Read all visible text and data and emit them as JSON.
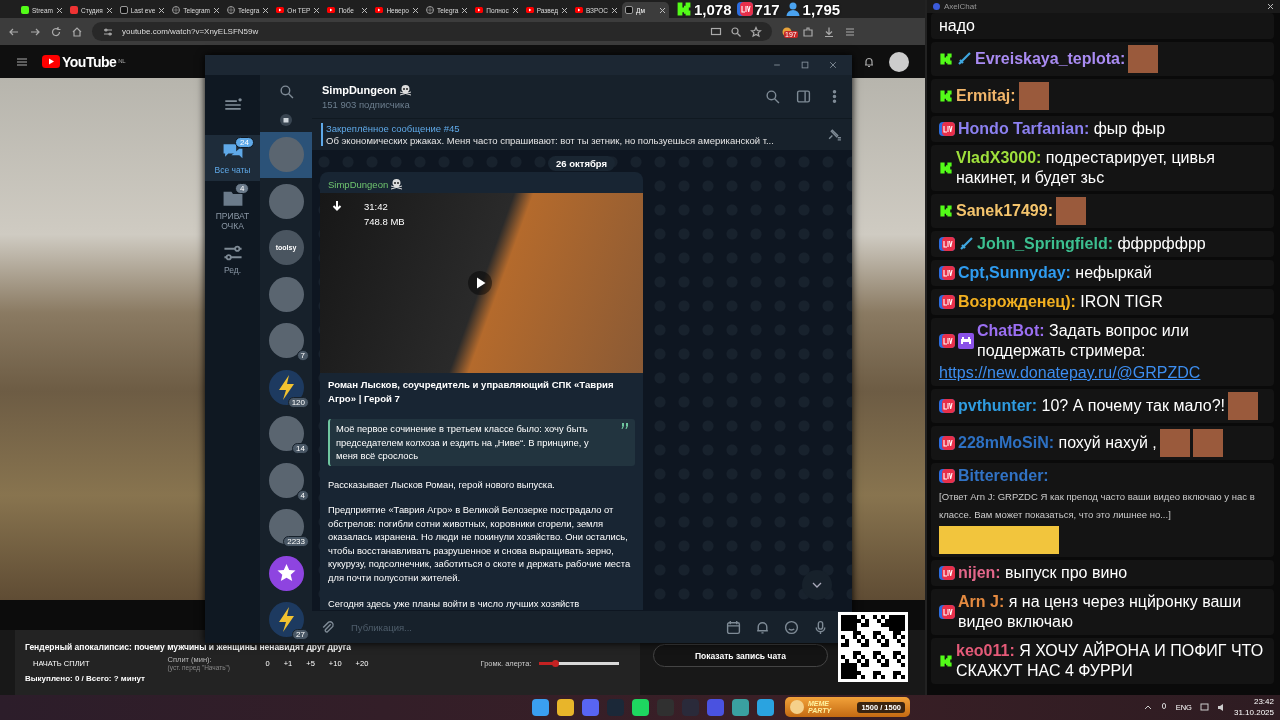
{
  "browser": {
    "tabs": [
      {
        "label": "Stream",
        "kind": "kick",
        "selected": false
      },
      {
        "label": "Студия",
        "kind": "studio",
        "selected": false
      },
      {
        "label": "Last eve",
        "kind": "dark",
        "selected": false
      },
      {
        "label": "Telegram",
        "kind": "globe",
        "selected": false
      },
      {
        "label": "Telegra",
        "kind": "globe",
        "selected": false
      },
      {
        "label": "Он ТЕР",
        "kind": "youtube",
        "selected": false
      },
      {
        "label": "Побе",
        "kind": "youtube",
        "selected": false
      },
      {
        "label": "Неверо",
        "kind": "youtube",
        "selected": false
      },
      {
        "label": "Telegra",
        "kind": "globe",
        "selected": false
      },
      {
        "label": "Полнос",
        "kind": "youtube",
        "selected": false
      },
      {
        "label": "Развед",
        "kind": "youtube",
        "selected": false
      },
      {
        "label": "ВЗРОС",
        "kind": "youtube",
        "selected": false
      },
      {
        "label": "Дм",
        "kind": "dark",
        "selected": true
      }
    ],
    "address": "youtube.com/watch?v=XnyELSFN59w",
    "extension_badge": "197"
  },
  "stream_overlay": {
    "kick_viewers": "1,078",
    "live_viewers": "717",
    "total_viewers": "1,795"
  },
  "youtube": {
    "logo": "YouTube",
    "region": "NL"
  },
  "telegram": {
    "folders": [
      {
        "label": "Все чаты",
        "kind": "chats",
        "badge": "24",
        "selected": true
      },
      {
        "label": "ПРИВАТ ОЧКА",
        "kind": "folder",
        "badge": "4",
        "selected": false
      },
      {
        "label": "Ред.",
        "kind": "edit",
        "selected": false
      }
    ],
    "chats": [
      {
        "kind": "photo",
        "selected": true
      },
      {
        "kind": "photo",
        "selected": false
      },
      {
        "kind": "logo",
        "avatar_text": "toolsy",
        "selected": false
      },
      {
        "kind": "photo",
        "selected": false
      },
      {
        "kind": "photo",
        "badge": "7",
        "selected": false
      },
      {
        "kind": "bolt",
        "badge": "120",
        "selected": false
      },
      {
        "kind": "photo",
        "badge": "14",
        "selected": false
      },
      {
        "kind": "photo",
        "badge": "4",
        "selected": false
      },
      {
        "kind": "photo",
        "badge": "2233",
        "selected": false
      },
      {
        "kind": "star",
        "selected": false
      },
      {
        "kind": "bolt",
        "badge": "27",
        "selected": false
      }
    ],
    "channel": {
      "name": "SimpDungeon",
      "subscribers": "151 903 подписчика"
    },
    "pinned": {
      "title": "Закреплённое сообщение #45",
      "text": "Об экономических ржаках.  Меня часто спрашивают: вот ты зетник, но пользуешься американской т..."
    },
    "date": "26 октября",
    "message": {
      "sender": "SimpDungeon",
      "video": {
        "duration": "31:42",
        "size": "748.8 MB"
      },
      "caption": "Роман Лысков, соучредитель и управляющий СПК «Таврия Агро» | Герой 7",
      "quote": "Моё первое сочинение в третьем классе было: хочу быть председателем колхоза и ездить на „Ниве“. В принципе, у меня всё срослось",
      "paragraphs": [
        "Рассказывает Лысков Роман, герой нового выпуска.",
        "Предприятие «Таврия Агро» в Великой Белозерке пострадало от обстрелов: погибли сотни животных, коровники сгорели, земля оказалась изранена. Но люди не покинули хозяйство. Они остались, чтобы восстанавливать разрушенное и снова выращивать зерно, кукурузу, подсолнечник, заботиться о скоте и держать рабочие места для почти полусотни жителей.",
        "Сегодня здесь уже планы войти в число лучших хозяйств"
      ]
    },
    "composer": {
      "placeholder": "Публикация..."
    }
  },
  "split_widget": {
    "title": "Гендерный апокалипсис: почему мужчины и женщины ненавидят друг друга",
    "start_button": "НАЧАТЬ СПЛИТ",
    "split_label": "Сплит (мин):",
    "split_hint": "(уст. перед \"Начать\")",
    "values": [
      "0",
      "+1",
      "+5",
      "+10",
      "+20"
    ],
    "volume_label": "Громк. алерта:",
    "volume": {
      "level": 0.2
    },
    "bought": "Выкуплено: 0 / Всего: ? минут"
  },
  "chat_record_button": "Показать запись чата",
  "meme_party": {
    "title": "MEME PARTY",
    "count": "1500 / 1500"
  },
  "chat": {
    "title": "AxelChat",
    "messages": [
      {
        "text": "надо"
      },
      {
        "icons": [
          {
            "kind": "kick"
          },
          {
            "kind": "sword"
          }
        ],
        "name": "Evreiskaya_teplota:",
        "color": "#a98bf2",
        "emotes": [
          {
            "kind": "square"
          }
        ]
      },
      {
        "icons": [
          {
            "kind": "kick"
          }
        ],
        "name": "Ermitaj:",
        "color": "#f2b66a",
        "emotes": [
          {
            "kind": "square"
          }
        ]
      },
      {
        "icons": [
          {
            "kind": "live"
          }
        ],
        "name": "Hondo Tarfanian:",
        "color": "#8c80f0",
        "text": "фыр фыр"
      },
      {
        "icons": [
          {
            "kind": "kick"
          }
        ],
        "name": "VladX3000:",
        "color": "#9fe03c",
        "text": "подрестарирует, цивья накинет, и будет зьс"
      },
      {
        "icons": [
          {
            "kind": "kick"
          }
        ],
        "name": "Sanek17499:",
        "color": "#f4c46c",
        "emotes": [
          {
            "kind": "square"
          }
        ]
      },
      {
        "icons": [
          {
            "kind": "live"
          },
          {
            "kind": "sword"
          }
        ],
        "name": "John_Springfield:",
        "color": "#3cbf90",
        "text": "ффррффрр"
      },
      {
        "icons": [
          {
            "kind": "live"
          }
        ],
        "name": "Cpt,Sunnyday:",
        "color": "#2f9cf0",
        "text": "нефыркай"
      },
      {
        "icons": [
          {
            "kind": "live"
          }
        ],
        "name": "Возрожденец):",
        "color": "#f2b020",
        "text": "IRON TIGR"
      },
      {
        "icons": [
          {
            "kind": "live"
          },
          {
            "kind": "bot"
          }
        ],
        "name": "ChatBot:",
        "color": "#9b6ff2",
        "text": "Задать вопрос или поддержать стримера:",
        "link": "https://new.donatepay.ru/@GRPZDC"
      },
      {
        "icons": [
          {
            "kind": "live"
          }
        ],
        "name": "pvthunter:",
        "color": "#2f9ce0",
        "text": "10? А почему так мало?!",
        "emotes": [
          {
            "kind": "square"
          }
        ]
      },
      {
        "icons": [
          {
            "kind": "live"
          }
        ],
        "name": "228mMoSiN:",
        "color": "#2d70c2",
        "text": "похуй нахуй ,",
        "emotes": [
          {
            "kind": "square"
          },
          {
            "kind": "square"
          }
        ]
      },
      {
        "icons": [
          {
            "kind": "live"
          }
        ],
        "name": "Bitterender:",
        "color": "#3172c4",
        "reply": "[Ответ Arn J: GRPZDC Я как препод часто ваши видео включаю у нас в классе. Вам может показаться, что это лишнее но...]",
        "emotes": [
          {
            "kind": "wide"
          }
        ]
      },
      {
        "icons": [
          {
            "kind": "live"
          }
        ],
        "name": "nijen:",
        "color": "#e2668a",
        "text": "выпуск про вино"
      },
      {
        "icons": [
          {
            "kind": "live"
          }
        ],
        "name": "Arn J:",
        "color": "#e48a40",
        "text": "я на ценз через нцйронку ваши видео включаю"
      },
      {
        "icons": [
          {
            "kind": "kick"
          }
        ],
        "name": "keo011:",
        "color": "#e45a78",
        "text": "Я ХОЧУ АЙРОНА И ПОФИГ ЧТО СКАЖУТ НАС 4 ФУРРИ"
      }
    ]
  },
  "taskbar": {
    "apps": [
      {
        "kind": "windows"
      },
      {
        "kind": "chrome"
      },
      {
        "kind": "discord"
      },
      {
        "kind": "steam"
      },
      {
        "kind": "spotify"
      },
      {
        "kind": "obs"
      },
      {
        "kind": "terminal"
      },
      {
        "kind": "media"
      },
      {
        "kind": "snip"
      },
      {
        "kind": "telegram"
      }
    ],
    "language": "ENG",
    "time": "23:42",
    "date": "31.10.2025"
  }
}
